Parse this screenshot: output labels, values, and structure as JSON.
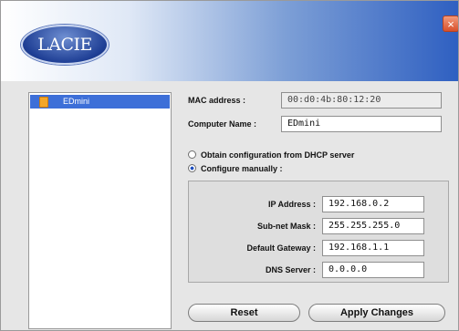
{
  "header": {
    "logo_text": "LACIE",
    "close_glyph": "×"
  },
  "sidebar": {
    "items": [
      {
        "label": "EDmini",
        "icon": "hard-drive-icon",
        "selected": true
      }
    ]
  },
  "form": {
    "mac_label": "MAC address :",
    "mac_value": "00:d0:4b:80:12:20",
    "name_label": "Computer Name :",
    "name_value": "EDmini",
    "dhcp_label": "Obtain configuration from DHCP server",
    "manual_label": "Configure manually :",
    "selected_mode": "manual"
  },
  "network": {
    "ip_label": "IP Address :",
    "ip_value": "192.168.0.2",
    "mask_label": "Sub-net Mask :",
    "mask_value": "255.255.255.0",
    "gateway_label": "Default Gateway :",
    "gateway_value": "192.168.1.1",
    "dns_label": "DNS Server :",
    "dns_value": "0.0.0.0"
  },
  "buttons": {
    "reset_label": "Reset",
    "apply_label": "Apply Changes"
  },
  "colors": {
    "accent": "#3d6fd8",
    "header_blue": "#2e5fc1",
    "close_red": "#d8502c"
  }
}
